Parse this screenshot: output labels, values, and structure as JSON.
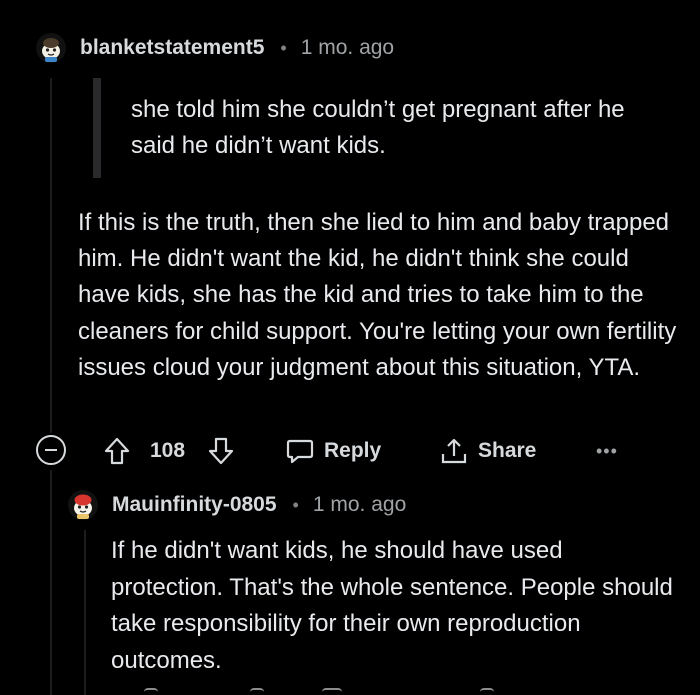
{
  "comments": [
    {
      "username": "blanketstatement5",
      "separator": "•",
      "time": "1 mo. ago",
      "quote": "she told him she couldn’t get pregnant after he said he didn’t want kids.",
      "body": "If this is the truth, then she lied to him and baby trapped him. He didn't want the kid, he didn't think she could have kids, she has the kid and tries to take him to the cleaners for child support. You're letting your own fertility issues cloud your judgment about this situation, YTA.",
      "actions": {
        "votes": "108",
        "reply_label": "Reply",
        "share_label": "Share",
        "more_label": "•••"
      }
    },
    {
      "username": "Mauinfinity-0805",
      "separator": "•",
      "time": "1 mo. ago",
      "body": "If he didn't want kids, he should have used protection. That's the whole sentence. People should take responsibility for their own reproduction outcomes."
    }
  ],
  "colors": {
    "background": "#000000",
    "text": "#e8eaed",
    "muted": "#a0a3a6",
    "thread_line": "#1c1c1e"
  },
  "icons": [
    "avatar-snoo-icon",
    "collapse-icon",
    "upvote-icon",
    "downvote-icon",
    "reply-bubble-icon",
    "share-icon",
    "more-icon"
  ]
}
